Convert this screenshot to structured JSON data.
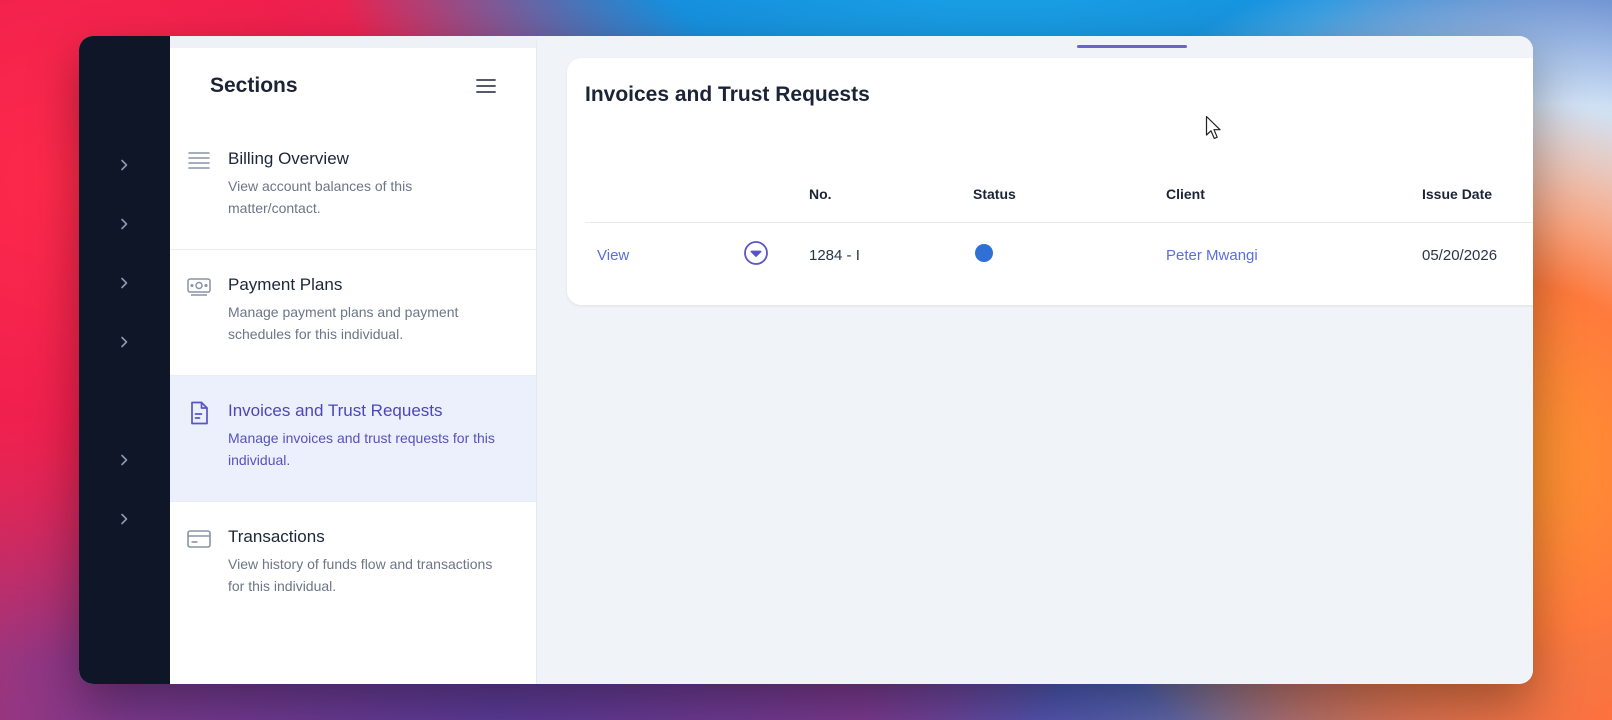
{
  "sections": {
    "title": "Sections",
    "items": [
      {
        "title": "Billing Overview",
        "desc": "View account balances of this matter/contact.",
        "icon": "list-icon"
      },
      {
        "title": "Payment Plans",
        "desc": "Manage payment plans and payment schedules for this individual.",
        "icon": "money-icon"
      },
      {
        "title": "Invoices and Trust Requests",
        "desc": "Manage invoices and trust requests for this individual.",
        "icon": "document-icon",
        "active": true
      },
      {
        "title": "Transactions",
        "desc": "View history of funds flow and transactions for this individual.",
        "icon": "card-icon"
      }
    ]
  },
  "main": {
    "title": "Invoices and Trust Requests",
    "table": {
      "headers": {
        "no": "No.",
        "status": "Status",
        "client": "Client",
        "issue_date": "Issue Date"
      },
      "rows": [
        {
          "action": "View",
          "no": "1284 - I",
          "client": "Peter Mwangi",
          "issue_date": "05/20/2026"
        }
      ]
    }
  },
  "colors": {
    "accent": "#5b53c9",
    "link": "#5a6fd8",
    "status_dot": "#2f6fd6",
    "rail": "#0e1628",
    "active_bg": "#eceffc"
  }
}
